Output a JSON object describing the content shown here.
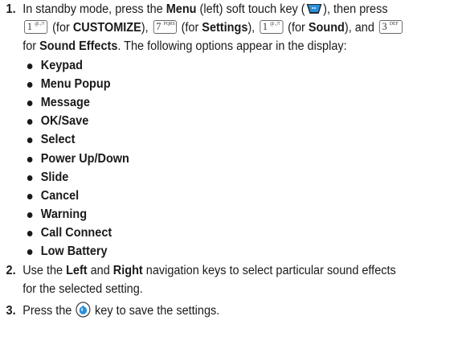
{
  "steps": [
    {
      "number": "1.",
      "text": {
        "t1": "In standby mode, press the ",
        "menu": "Menu",
        "t2": " (left) soft touch key (",
        "t3": "), then press",
        "t4": " (for ",
        "customize": "CUSTOMIZE",
        "t5": "), ",
        "t6": " (for ",
        "settings": "Settings",
        "t7": "), ",
        "t8": " (for ",
        "sound": "Sound",
        "t9": "), and ",
        "t10": "for ",
        "sound_effects": "Sound Effects",
        "t11": ". The following options appear in the display:"
      },
      "keys": {
        "k1": {
          "main": "1",
          "sub": "@.,?!"
        },
        "k7": {
          "main": "7",
          "sub": "PQRS"
        },
        "k3": {
          "main": "3",
          "sub": "DEF"
        }
      },
      "options": [
        "Keypad",
        "Menu Popup",
        "Message",
        "OK/Save",
        "Select",
        "Power Up/Down",
        "Slide",
        "Cancel",
        "Warning",
        "Call Connect",
        "Low Battery"
      ]
    },
    {
      "number": "2.",
      "text": {
        "t1": "Use the ",
        "left": "Left",
        "t2": " and ",
        "right": "Right",
        "t3": " navigation keys to select particular sound effects",
        "t4": "for the selected setting."
      }
    },
    {
      "number": "3.",
      "text": {
        "t1": "Press the ",
        "t2": " key to save the settings."
      }
    }
  ],
  "icons": {
    "soft_key": "left-soft-key-icon",
    "ok_key": "ok-key-icon"
  },
  "colors": {
    "soft_key": "#2a8fd8",
    "ok_key": "#2a8fd8",
    "text": "#1a1a1a"
  }
}
